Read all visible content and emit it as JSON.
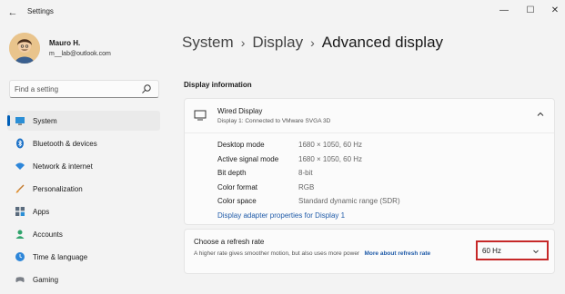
{
  "window": {
    "title": "Settings",
    "back_glyph": "←",
    "min_glyph": "—",
    "max_glyph": "☐",
    "close_glyph": "✕"
  },
  "user": {
    "name": "Mauro H.",
    "email": "m__lab@outlook.com"
  },
  "search": {
    "placeholder": "Find a setting",
    "icon": "search-icon"
  },
  "sidebar": {
    "items": [
      {
        "label": "System",
        "icon": "system-icon",
        "active": true
      },
      {
        "label": "Bluetooth & devices",
        "icon": "bluetooth-icon"
      },
      {
        "label": "Network & internet",
        "icon": "wifi-icon"
      },
      {
        "label": "Personalization",
        "icon": "brush-icon"
      },
      {
        "label": "Apps",
        "icon": "apps-icon"
      },
      {
        "label": "Accounts",
        "icon": "accounts-icon"
      },
      {
        "label": "Time & language",
        "icon": "globe-clock-icon"
      },
      {
        "label": "Gaming",
        "icon": "gaming-icon"
      }
    ]
  },
  "breadcrumb": {
    "items": [
      "System",
      "Display"
    ],
    "current": "Advanced display",
    "separator": "›"
  },
  "display_info": {
    "section_title": "Display information",
    "name": "Wired Display",
    "subtitle": "Display 1: Connected to VMware SVGA 3D",
    "properties": [
      {
        "label": "Desktop mode",
        "value": "1680 × 1050, 60 Hz"
      },
      {
        "label": "Active signal mode",
        "value": "1680 × 1050, 60 Hz"
      },
      {
        "label": "Bit depth",
        "value": "8-bit"
      },
      {
        "label": "Color format",
        "value": "RGB"
      },
      {
        "label": "Color space",
        "value": "Standard dynamic range (SDR)"
      }
    ],
    "adapter_link": "Display adapter properties for Display 1"
  },
  "refresh_rate": {
    "title": "Choose a refresh rate",
    "description": "A higher rate gives smoother motion, but also uses more power",
    "more_link": "More about refresh rate",
    "selected": "60 Hz"
  },
  "colors": {
    "accent": "#005fb8",
    "link": "#1e5aa8",
    "highlight_border": "#c62828"
  }
}
